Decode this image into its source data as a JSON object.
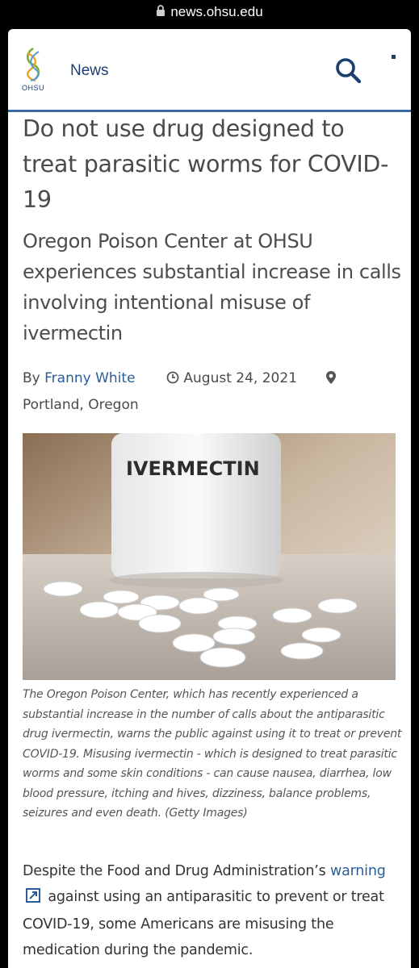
{
  "browser": {
    "url": "news.ohsu.edu"
  },
  "header": {
    "logo_text": "OHSU",
    "news_label": "News"
  },
  "article": {
    "headline": "Do not use drug designed to treat parasitic worms for COVID-19",
    "subhead": "Oregon Poison Center at OHSU experiences substantial increase in calls involving intentional misuse of ivermectin",
    "by_label": "By",
    "author": "Franny White",
    "date": "August 24, 2021",
    "location": "Portland, Oregon",
    "image_label": "IVERMECTIN",
    "caption": "The Oregon Poison Center, which has recently experienced a substantial increase in the number of calls about the antiparasitic drug ivermectin, warns the public against using it to treat or prevent COVID-19. Misusing ivermectin - which is designed to treat parasitic worms and some skin conditions - can cause nausea, diarrhea, low blood pressure, itching and hives, dizziness, balance problems, seizures and even death. (Getty Images)",
    "body_before": "Despite the Food and Drug Administration’s ",
    "body_link": "warning",
    "body_after": " against using an antiparasitic to prevent or treat COVID-19, some Americans are misusing the medication during the pandemic."
  },
  "icons": {
    "lock": "lock-icon",
    "search": "search-icon",
    "clock": "clock-icon",
    "pin": "map-pin-icon",
    "external": "external-link-icon"
  },
  "colors": {
    "brand_blue": "#1a3e6e",
    "link_blue": "#2a5d98",
    "header_rule": "#3b6aa1"
  }
}
